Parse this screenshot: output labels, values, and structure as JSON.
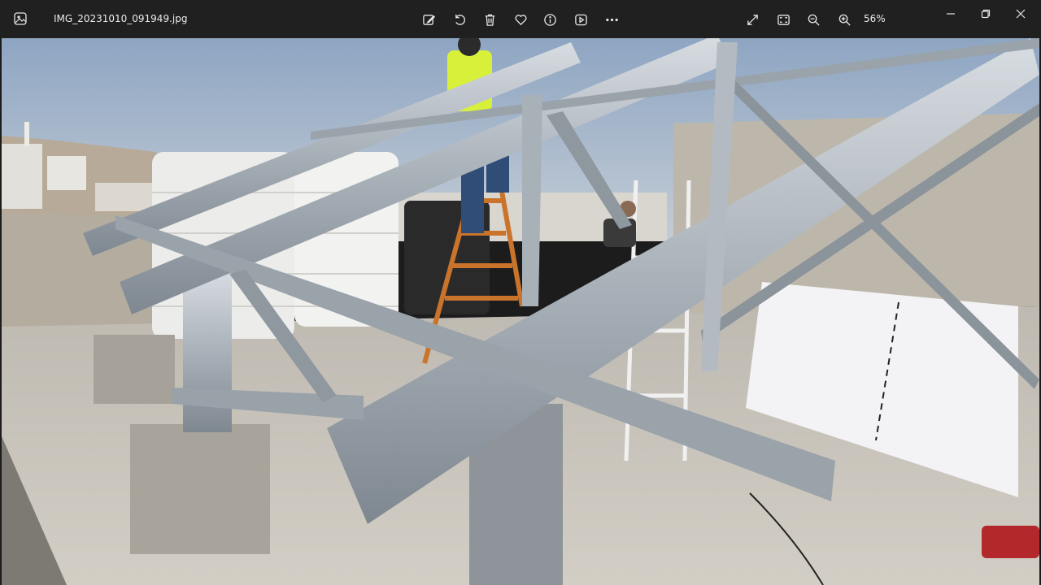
{
  "window": {
    "filename": "IMG_20231010_091949.jpg",
    "zoom_level": "56%"
  },
  "toolbar": {
    "icons": [
      "edit-image-icon",
      "rotate-icon",
      "delete-icon",
      "favorite-icon",
      "info-icon",
      "slideshow-icon",
      "more-icon"
    ],
    "right_icons": [
      "fullscreen-icon",
      "fit-to-window-icon",
      "zoom-out-icon",
      "zoom-in-icon"
    ]
  },
  "colors": {
    "titlebar": "#202020",
    "sky": "#9fb3c9",
    "steel": "#b9c0c7",
    "concrete": "#c9c3b8"
  }
}
